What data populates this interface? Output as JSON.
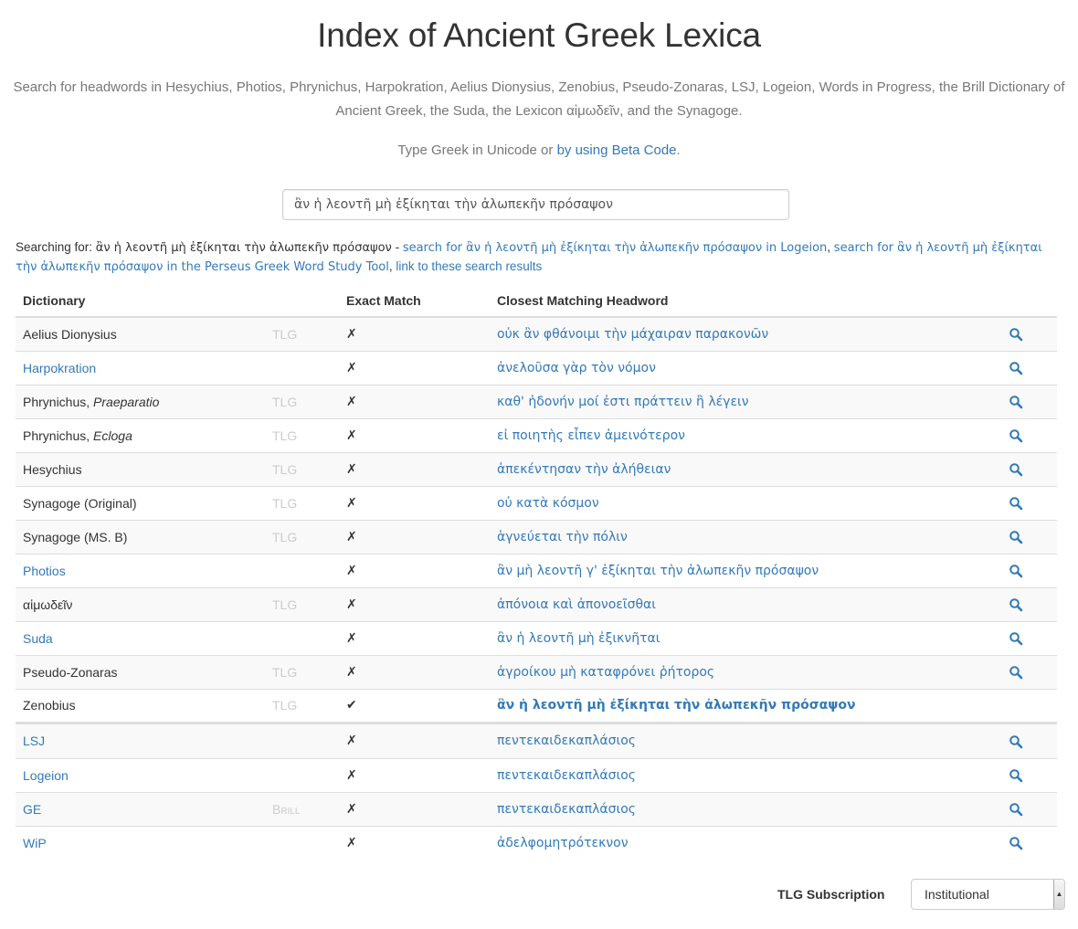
{
  "page": {
    "title": "Index of Ancient Greek Lexica",
    "description": "Search for headwords in Hesychius, Photios, Phrynichus, Harpokration, Aelius Dionysius, Zenobius, Pseudo-Zonaras, LSJ, Logeion, Words in Progress, the Brill Dictionary of Ancient Greek, the Suda, the Lexicon αἱμωδεῖν, and the Synagoge.",
    "unicode_prefix": "Type Greek in Unicode or ",
    "beta_code_link": "by using Beta Code",
    "unicode_suffix": "."
  },
  "search": {
    "value": "ἂν ἡ λεοντῆ μὴ ἐξίκηται τὴν ἀλωπεκῆν πρόσαψον"
  },
  "searching": {
    "prefix": "Searching for: ",
    "term": "ἂν ἡ λεοντῆ μὴ ἐξίκηται τὴν ἀλωπεκῆν πρόσαψον",
    "separator1": " - ",
    "logeion_link": "search for ἂν ἡ λεοντῆ μὴ ἐξίκηται τὴν ἀλωπεκῆν πρόσαψον in Logeion",
    "separator2": ", ",
    "perseus_link": "search for ἂν ἡ λεοντῆ μὴ ἐξίκηται τὴν ἀλωπεκῆν πρόσαψον in the Perseus Greek Word Study Tool",
    "separator3": ", ",
    "results_link": "link to these search results"
  },
  "table": {
    "headers": [
      "Dictionary",
      "",
      "Exact Match",
      "Closest Matching Headword",
      ""
    ],
    "rows": [
      {
        "name": "Aelius Dionysius",
        "work": "",
        "link": false,
        "source": "TLG",
        "exact": "✗",
        "headword": "οὐκ ἂν φθάνοιμι τὴν μάχαιραν παρακονῶν",
        "icon": "search-icon"
      },
      {
        "name": "Harpokration",
        "work": "",
        "link": true,
        "source": "",
        "exact": "✗",
        "headword": "ἀνελοῦσα γὰρ τὸν νόμον",
        "icon": "search-icon"
      },
      {
        "name": "Phrynichus, ",
        "work": "Praeparatio",
        "link": false,
        "source": "TLG",
        "exact": "✗",
        "headword": "καθ' ἡδονήν μοί ἐστι πράττειν ἢ λέγειν",
        "icon": "search-icon"
      },
      {
        "name": "Phrynichus, ",
        "work": "Ecloga",
        "link": false,
        "source": "TLG",
        "exact": "✗",
        "headword": "εἰ ποιητὴς εἶπεν ἀμεινότερον",
        "icon": "search-icon"
      },
      {
        "name": "Hesychius",
        "work": "",
        "link": false,
        "source": "TLG",
        "exact": "✗",
        "headword": "ἀπεκέντησαν τὴν ἀλήθειαν",
        "icon": "search-icon"
      },
      {
        "name": "Synagoge (Original)",
        "work": "",
        "link": false,
        "source": "TLG",
        "exact": "✗",
        "headword": "οὐ κατὰ κόσμον",
        "icon": "search-icon"
      },
      {
        "name": "Synagoge (MS. B)",
        "work": "",
        "link": false,
        "source": "TLG",
        "exact": "✗",
        "headword": "ἁγνεύεται τὴν πόλιν",
        "icon": "search-icon"
      },
      {
        "name": "Photios",
        "work": "",
        "link": true,
        "source": "",
        "exact": "✗",
        "headword": "ἂν μὴ λεοντῆ γ' ἐξίκηται τὴν ἀλωπεκῆν πρόσαψον",
        "icon": "search-icon"
      },
      {
        "name": "αἱμωδεῖν",
        "work": "",
        "link": false,
        "source": "TLG",
        "exact": "✗",
        "headword": "ἀπόνοια καὶ ἀπονοεῖσθαι",
        "icon": "search-icon"
      },
      {
        "name": "Suda",
        "work": "",
        "link": true,
        "source": "",
        "exact": "✗",
        "headword": "ἂν ἡ λεοντῆ μὴ ἐξικνῆται",
        "icon": "search-icon"
      },
      {
        "name": "Pseudo-Zonaras",
        "work": "",
        "link": false,
        "source": "TLG",
        "exact": "✗",
        "headword": "ἀγροίκου μὴ καταφρόνει ῥήτορος",
        "icon": "search-icon"
      },
      {
        "name": "Zenobius",
        "work": "",
        "link": false,
        "source": "TLG",
        "exact": "✔",
        "headword": "ἂν ἡ λεοντῆ μὴ ἐξίκηται τὴν ἀλωπεκῆν πρόσαψον",
        "icon": "",
        "bold": true
      },
      {
        "name": "LSJ",
        "work": "",
        "link": true,
        "source": "",
        "exact": "✗",
        "headword": "πεντεκαιδεκαπλάσιος",
        "icon": "search-icon",
        "divider": true
      },
      {
        "name": "Logeion",
        "work": "",
        "link": true,
        "source": "",
        "exact": "✗",
        "headword": "πεντεκαιδεκαπλάσιος",
        "icon": "search-icon"
      },
      {
        "name": "GE",
        "work": "",
        "link": true,
        "source": "Brill",
        "exact": "✗",
        "headword": "πεντεκαιδεκαπλάσιος",
        "icon": "search-icon"
      },
      {
        "name": "WiP",
        "work": "",
        "link": true,
        "source": "",
        "exact": "✗",
        "headword": "ἀδελφομητρότεκνον",
        "icon": "search-icon"
      }
    ]
  },
  "subscription": {
    "label": "TLG Subscription",
    "selected": "Institutional"
  },
  "colors": {
    "link": "#337ab7",
    "muted": "#777777",
    "source_badge": "#cccccc"
  }
}
